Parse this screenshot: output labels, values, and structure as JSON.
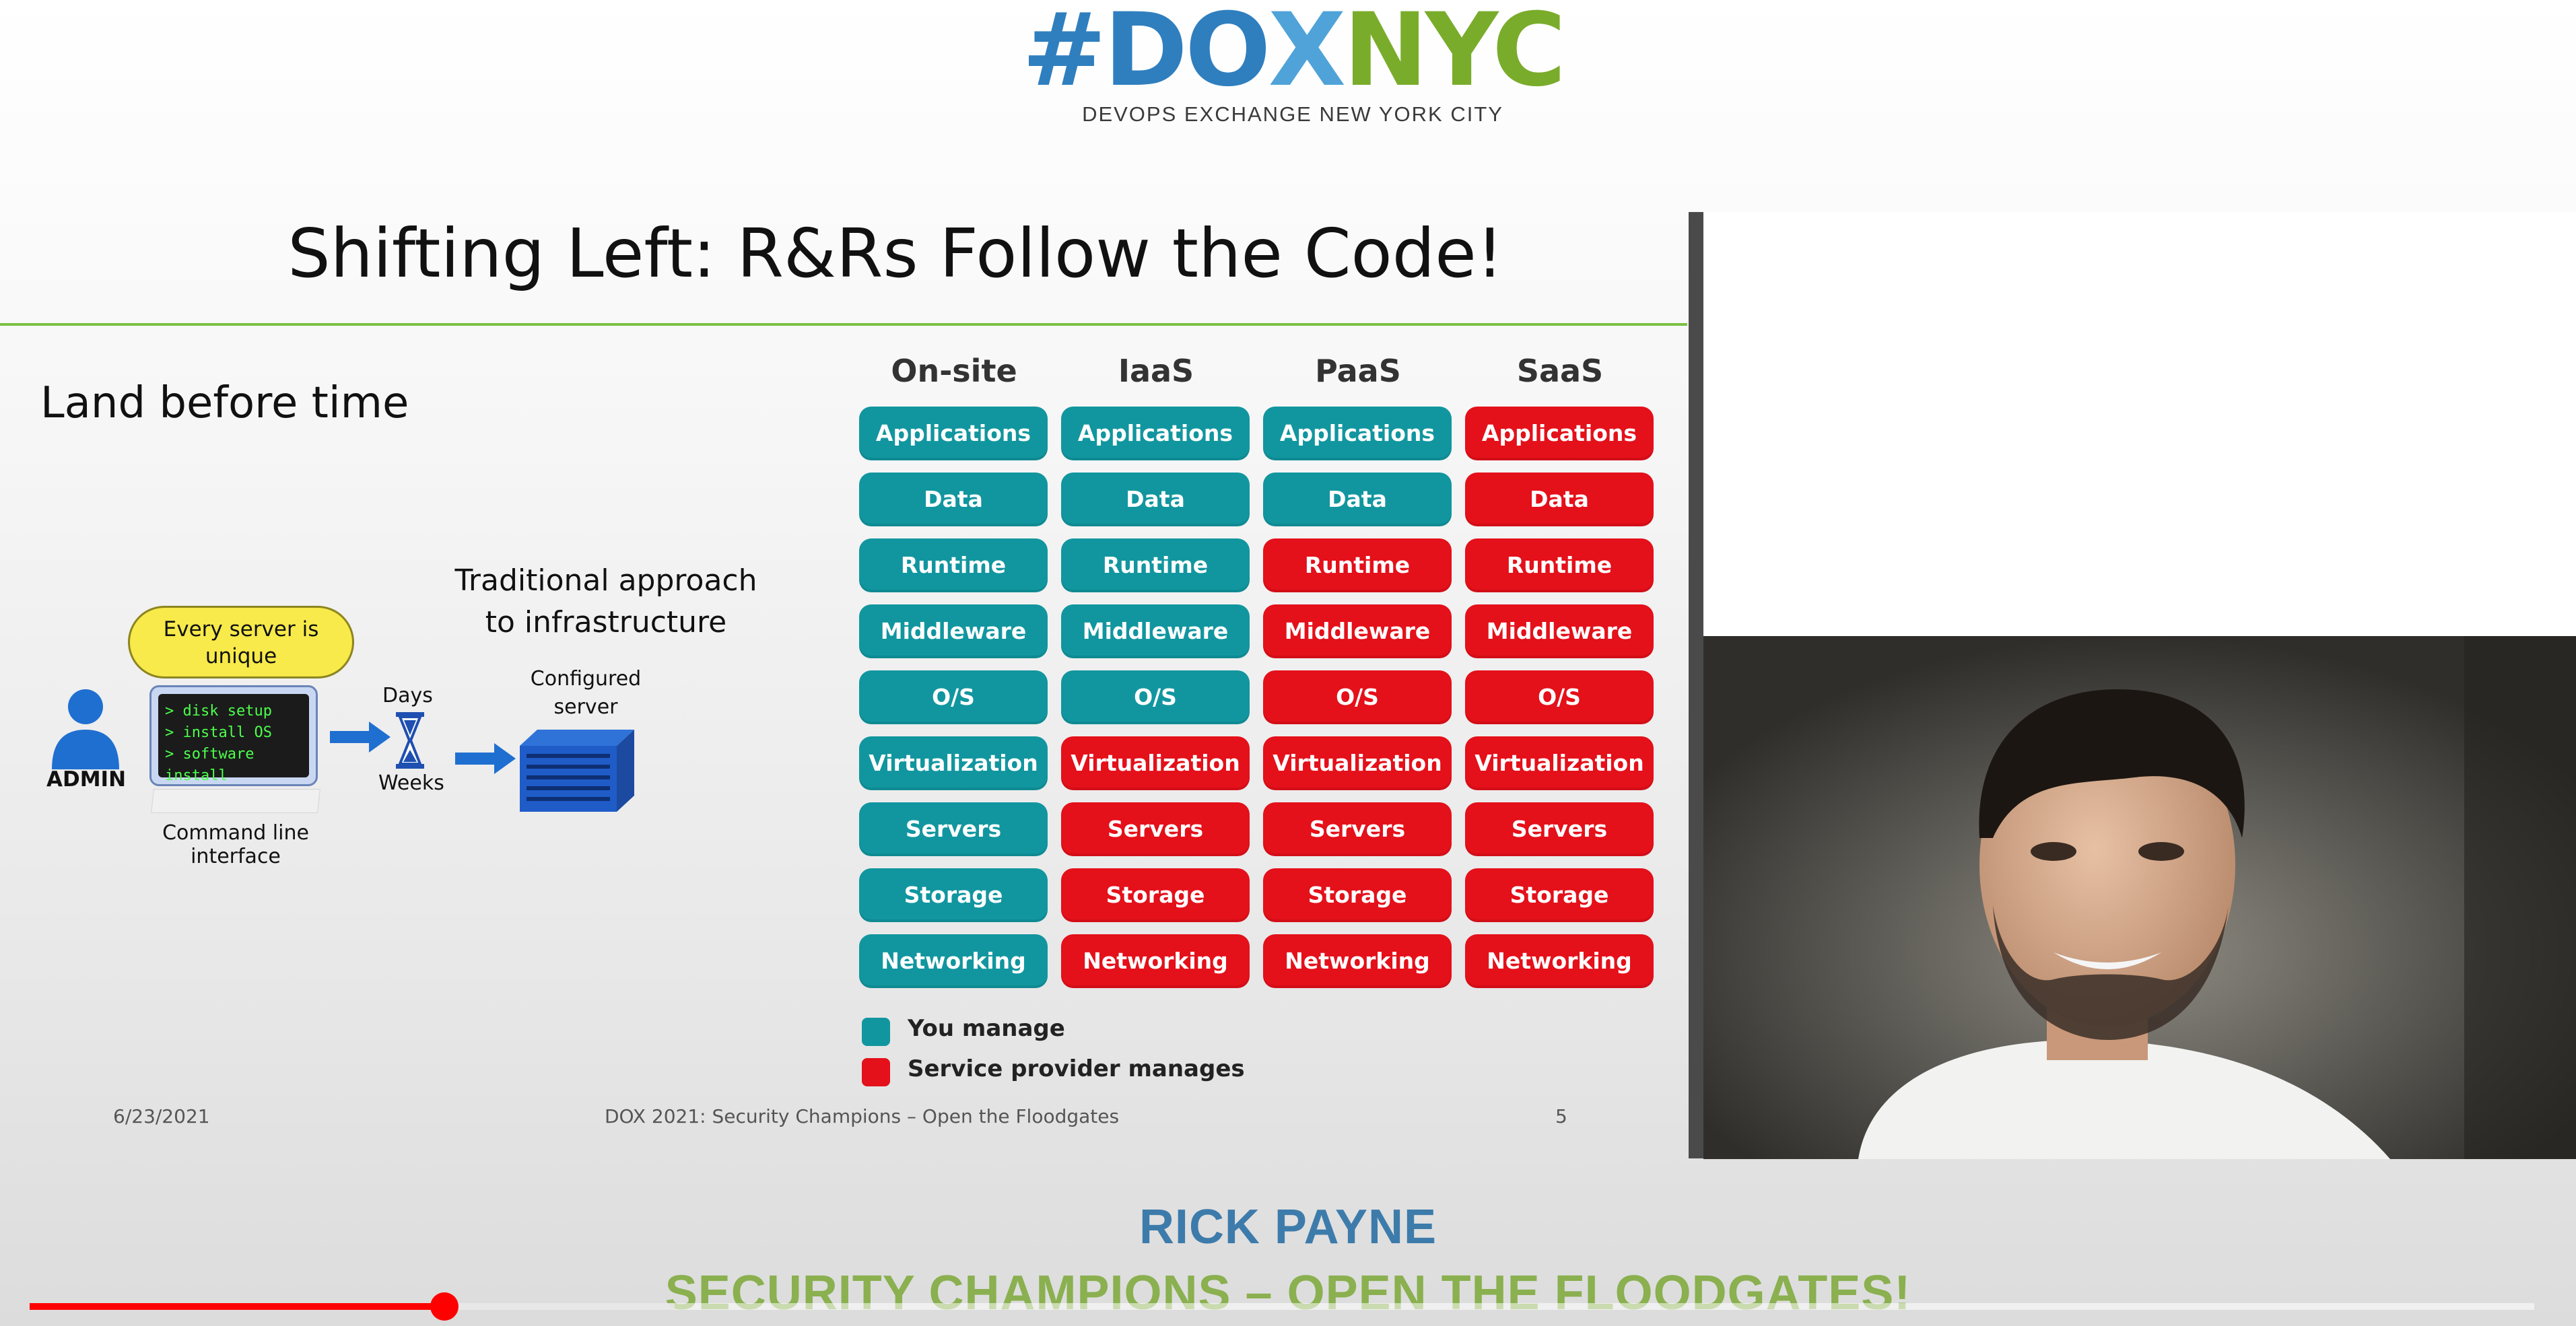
{
  "logo": {
    "hash": "#",
    "do": "DO",
    "x": "X",
    "nyc": "NYC",
    "subtitle": "DEVOPS EXCHANGE NEW YORK CITY"
  },
  "slide": {
    "title": "Shifting Left: R&Rs Follow the Code!",
    "subtitle": "Land before time",
    "diagram": {
      "traditional_line1": "Traditional approach",
      "traditional_line2": "to infrastructure",
      "bubble_line1": "Every server is",
      "bubble_line2": "unique",
      "admin_label": "ADMIN",
      "terminal_lines": [
        "> disk setup",
        "> install OS",
        "> software install"
      ],
      "cli_label": "Command line interface",
      "days_label": "Days",
      "weeks_label": "Weeks",
      "configured_line1": "Configured",
      "configured_line2": "server"
    },
    "grid": {
      "columns": [
        "On-site",
        "IaaS",
        "PaaS",
        "SaaS"
      ],
      "rows": [
        "Applications",
        "Data",
        "Runtime",
        "Middleware",
        "O/S",
        "Virtualization",
        "Servers",
        "Storage",
        "Networking"
      ],
      "managed_by": [
        [
          "you",
          "you",
          "you",
          "provider"
        ],
        [
          "you",
          "you",
          "you",
          "provider"
        ],
        [
          "you",
          "you",
          "provider",
          "provider"
        ],
        [
          "you",
          "you",
          "provider",
          "provider"
        ],
        [
          "you",
          "you",
          "provider",
          "provider"
        ],
        [
          "you",
          "provider",
          "provider",
          "provider"
        ],
        [
          "you",
          "provider",
          "provider",
          "provider"
        ],
        [
          "you",
          "provider",
          "provider",
          "provider"
        ],
        [
          "you",
          "provider",
          "provider",
          "provider"
        ]
      ]
    },
    "legend": {
      "you": "You manage",
      "provider": "Service provider manages"
    },
    "colors": {
      "you": "#11969f",
      "provider": "#e4101a",
      "rule": "#7ac143"
    },
    "footer": {
      "date": "6/23/2021",
      "event": "DOX 2021: Security Champions – Open the Floodgates",
      "page": "5"
    }
  },
  "lower_third": {
    "speaker": "RICK PAYNE",
    "talk_title": "SECURITY CHAMPIONS – OPEN THE FLOODGATES!"
  },
  "player": {
    "progress_fraction": 0.1655,
    "buffered_fraction": 0.092
  }
}
